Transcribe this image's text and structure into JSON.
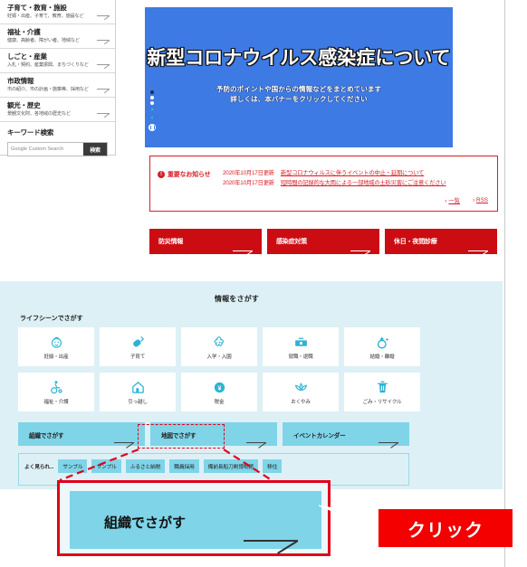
{
  "sidebar": {
    "items": [
      {
        "title": "子育て・教育・施設",
        "subtitle": "妊娠・出産、子育て、教育、施設など",
        "arrow_icon": "diagonal-arrow-icon"
      },
      {
        "title": "福祉・介護",
        "subtitle": "健康、高齢者、障がい者、地域など",
        "arrow_icon": "diagonal-arrow-icon"
      },
      {
        "title": "しごと・産業",
        "subtitle": "入札・契約、産業振興、まちづくりなど",
        "arrow_icon": "diagonal-arrow-icon"
      },
      {
        "title": "市政情報",
        "subtitle": "市の紹介、市の計画・施策等、採用など",
        "arrow_icon": "diagonal-arrow-icon"
      },
      {
        "title": "観光・歴史",
        "subtitle": "景観文化財、各地域の歴史など",
        "arrow_icon": "diagonal-arrow-icon"
      }
    ],
    "keyword_search": {
      "title": "キーワード検索",
      "placeholder": "Google Custom Search",
      "value": "",
      "button_label": "検索"
    }
  },
  "hero": {
    "title": "新型コロナウイルス感染症について",
    "subtitle_line1": "予防のポイントや国からの情報などをまとめています",
    "subtitle_line2": "詳しくは、本バナーをクリックしてください",
    "bg_color": "#3e7ae4",
    "carousel": {
      "dots": 3,
      "active_dot": 1,
      "next_icon": "chevron-right-icon",
      "prev_icon": "chevron-left-icon",
      "pause_icon": "pause-icon"
    }
  },
  "news": {
    "label": "重要なお知らせ",
    "alert_icon": "exclamation-icon",
    "accent_color": "#d81f26",
    "rows": [
      {
        "date": "2020年10月17日更新",
        "link": "新型コロナウィルスに伴うイベントの中止・延期について"
      },
      {
        "date": "2020年10月17日更新",
        "link": "短時間の記録的な大雨による一部地域の土砂災害にご注意ください"
      }
    ],
    "footer_links": [
      {
        "bullet": "›",
        "label": "一覧"
      },
      {
        "bullet": "›",
        "label": "RSS"
      }
    ]
  },
  "red_buttons": [
    {
      "label": "防災情報",
      "arrow_icon": "diagonal-arrow-icon"
    },
    {
      "label": "感染症対策",
      "arrow_icon": "diagonal-arrow-icon"
    },
    {
      "label": "休日・夜間診療",
      "arrow_icon": "diagonal-arrow-icon"
    }
  ],
  "search_panel": {
    "title": "情報をさがす",
    "subtitle": "ライフシーンでさがす",
    "bg_color": "#ddf0f5",
    "icon_rows": [
      [
        {
          "label": "妊娠・出産",
          "icon": "baby-face-icon"
        },
        {
          "label": "子育て",
          "icon": "baby-bottle-icon"
        },
        {
          "label": "入学・入園",
          "icon": "cherry-blossom-icon"
        },
        {
          "label": "就職・退職",
          "icon": "briefcase-icon"
        },
        {
          "label": "結婚・離婚",
          "icon": "ring-icon"
        }
      ],
      [
        {
          "label": "福祉・介護",
          "icon": "wheelchair-icon"
        },
        {
          "label": "引っ越し",
          "icon": "house-icon"
        },
        {
          "label": "税金",
          "icon": "yen-coin-icon"
        },
        {
          "label": "おくやみ",
          "icon": "lotus-icon"
        },
        {
          "label": "ごみ・リサイクル",
          "icon": "trash-bin-icon"
        }
      ]
    ],
    "blue_buttons": [
      {
        "label": "組織でさがす",
        "arrow_icon": "diagonal-arrow-icon",
        "highlighted": true
      },
      {
        "label": "地図でさがす",
        "arrow_icon": "diagonal-arrow-icon",
        "highlighted": false
      },
      {
        "label": "イベントカレンダー",
        "arrow_icon": "diagonal-arrow-icon",
        "highlighted": false
      }
    ],
    "tag_row": {
      "lead": "よく見られ...",
      "tags": [
        "サンプル",
        "サンプル",
        "ふるさと納税",
        "職員採用",
        "備前長船刀剣博物館",
        "移住"
      ]
    }
  },
  "callout": {
    "label": "組織でさがす",
    "arrow_icon": "diagonal-arrow-icon",
    "badge_label": "クリック",
    "badge_color": "#f50000",
    "border_color": "#e2001a",
    "button_color": "#7fd4e8"
  }
}
